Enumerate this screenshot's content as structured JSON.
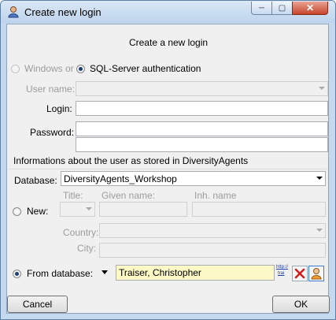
{
  "window": {
    "title": "Create new login"
  },
  "heading": "Create a new login",
  "auth": {
    "windows_label": "Windows or",
    "sql_label": "SQL-Server authentication"
  },
  "labels": {
    "username": "User name:",
    "login": "Login:",
    "password": "Password:",
    "section": "Informations about the user as stored in DiversityAgents",
    "database": "Database:",
    "title": "Title:",
    "given_name": "Given name:",
    "inh_name": "Inh. name",
    "new": "New:",
    "country": "Country:",
    "city": "City:",
    "from_database": "From database:"
  },
  "values": {
    "username": "",
    "login": "",
    "password": "",
    "database": "DiversityAgents_Workshop",
    "agent": "Traiser, Christopher"
  },
  "links": {
    "http": "http://",
    "trai": "trai"
  },
  "buttons": {
    "cancel": "Cancel",
    "ok": "OK"
  },
  "colors": {
    "highlight": "#fdf9c6",
    "titlebar": "#c5d9ee",
    "close_button": "#c7452c"
  },
  "icons": [
    "app-icon",
    "minimize-icon",
    "maximize-icon",
    "close-icon",
    "remove-icon",
    "agent-icon"
  ]
}
